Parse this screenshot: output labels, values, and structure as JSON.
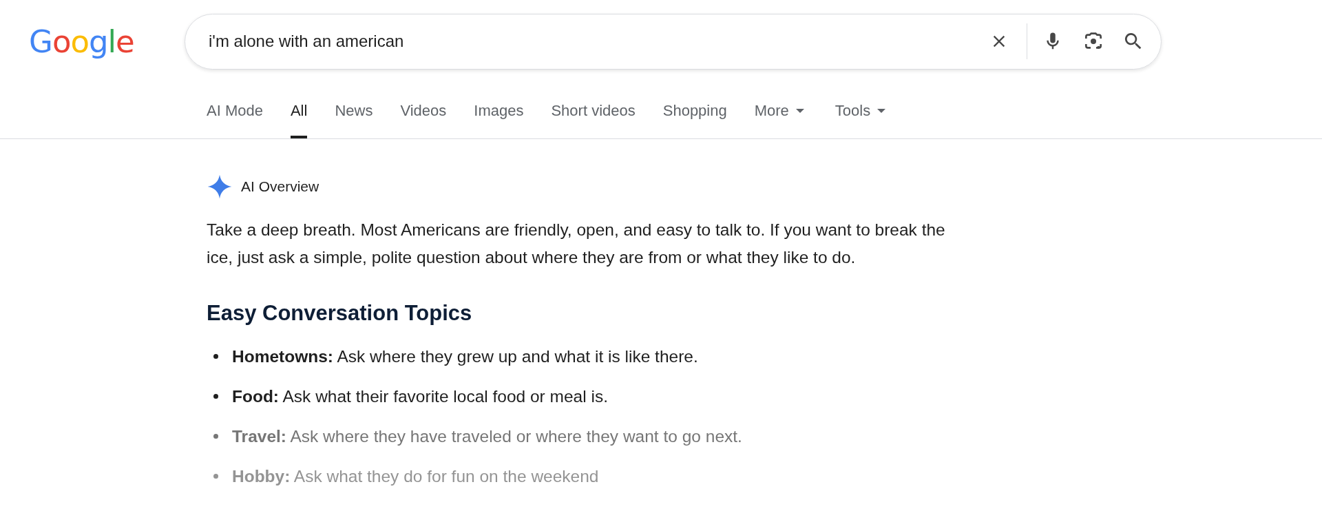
{
  "logo": {
    "letters": [
      {
        "char": "G",
        "color": "#4285f4"
      },
      {
        "char": "o",
        "color": "#ea4335"
      },
      {
        "char": "o",
        "color": "#fbbc05"
      },
      {
        "char": "g",
        "color": "#4285f4"
      },
      {
        "char": "l",
        "color": "#34a853"
      },
      {
        "char": "e",
        "color": "#ea4335"
      }
    ]
  },
  "search": {
    "value": "i'm alone with an american"
  },
  "tabs": [
    {
      "label": "AI Mode",
      "selected": false
    },
    {
      "label": "All",
      "selected": true
    },
    {
      "label": "News",
      "selected": false
    },
    {
      "label": "Videos",
      "selected": false
    },
    {
      "label": "Images",
      "selected": false
    },
    {
      "label": "Short videos",
      "selected": false
    },
    {
      "label": "Shopping",
      "selected": false
    },
    {
      "label": "More",
      "selected": false,
      "dropdown": true
    },
    {
      "label": "Tools",
      "selected": false,
      "dropdown": true
    }
  ],
  "overview": {
    "title": "AI Overview",
    "intro": "Take a deep breath. Most Americans are friendly, open, and easy to talk to. If you want to break the ice, just ask a simple, polite question about where they are from or what they like to do.",
    "heading": "Easy Conversation Topics",
    "items": [
      {
        "text": "**Hometowns:** Ask where they grew up and what it is like there."
      },
      {
        "text": "**Food:** Ask what their favorite local food or meal is."
      },
      {
        "text": "**Travel:** Ask where they have traveled or where they want to go next."
      },
      {
        "text": "**Hobby:** Ask what they do for fun on the weekend"
      }
    ]
  }
}
